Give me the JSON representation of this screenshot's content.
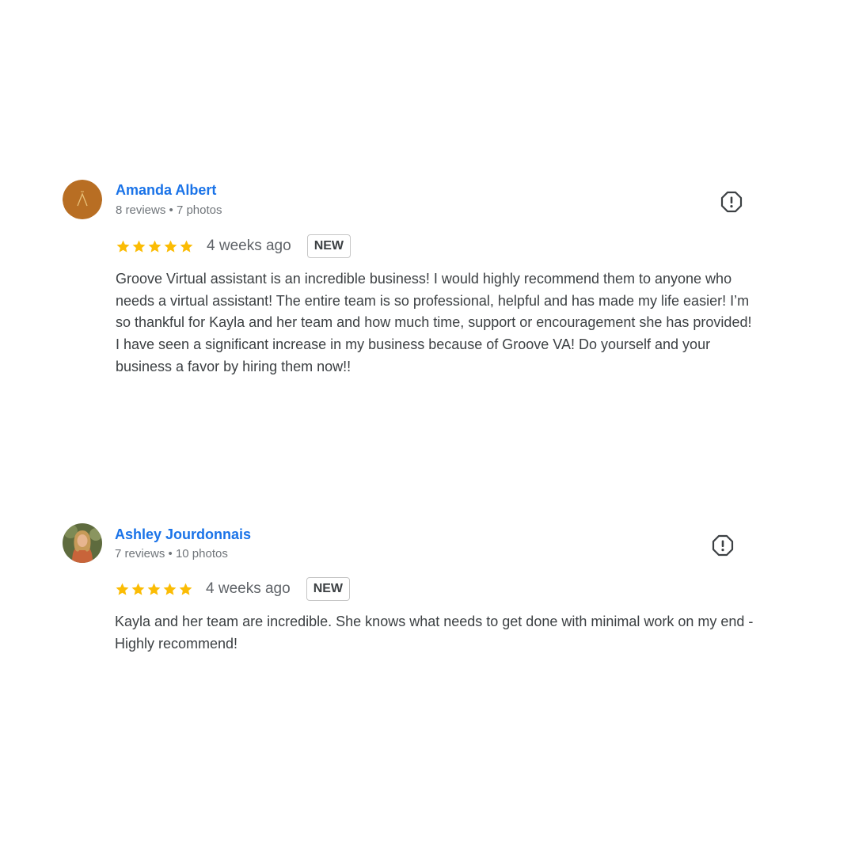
{
  "colors": {
    "author_link": "#1a73e8",
    "star": "#fbbc04",
    "meta_text": "#70757a",
    "body_text": "#3c4043"
  },
  "reviews": [
    {
      "author": "Amanda Albert",
      "meta": "8 reviews • 7 photos",
      "avatar": "amber-circle-logo-avatar",
      "rating": 5,
      "max_rating": 5,
      "time": "4 weeks ago",
      "badge": "NEW",
      "report_icon": "report-icon",
      "text": "Groove Virtual assistant is an incredible business! I would highly recommend them to anyone who needs a virtual assistant! The entire team is so professional, helpful and has made my life easier! I’m so thankful for Kayla and her team and how much time, support or encouragement she has provided! I have seen a significant increase in my business because of Groove VA! Do yourself and your business a favor by hiring them now!!"
    },
    {
      "author": "Ashley Jourdonnais",
      "meta": "7 reviews • 10 photos",
      "avatar": "profile-photo-avatar",
      "rating": 5,
      "max_rating": 5,
      "time": "4 weeks ago",
      "badge": "NEW",
      "report_icon": "report-icon",
      "text": "Kayla and her team are incredible. She knows what needs to get done with minimal work on my end - Highly recommend!"
    }
  ]
}
